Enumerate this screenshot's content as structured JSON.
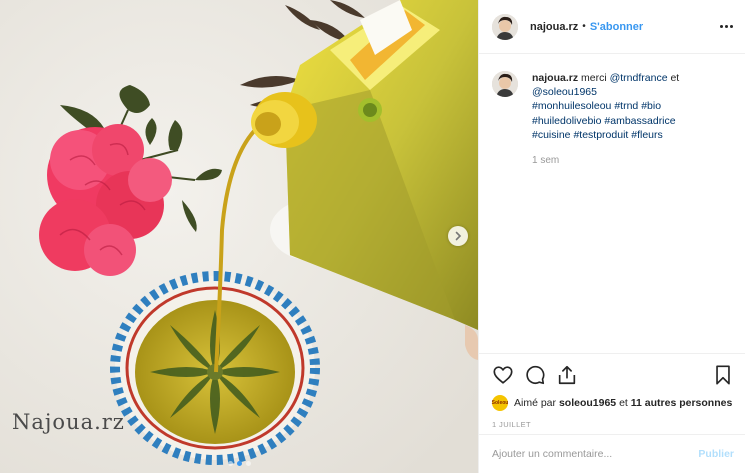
{
  "post": {
    "watermark": "Najoua.rz",
    "carousel": {
      "slide_count": 3,
      "active_index": 1
    }
  },
  "header": {
    "username": "najoua.rz",
    "separator": "•",
    "follow_label": "S'abonner"
  },
  "caption": {
    "username": "najoua.rz",
    "text_prefix": "merci",
    "mention1": "@trndfrance",
    "and_word": "et",
    "mention2": "@soleou1965",
    "hashtags": [
      "#monhuilesoleou",
      "#trnd",
      "#bio",
      "#huiledolivebio",
      "#ambassadrice",
      "#cuisine",
      "#testproduit",
      "#fleurs"
    ],
    "time": "1 sem"
  },
  "actions": {
    "icons": [
      "heart-icon",
      "comment-icon",
      "share-icon",
      "bookmark-icon"
    ],
    "likes_prefix": "Aimé par",
    "likes_user": "soleou1965",
    "likes_middle": "et",
    "likes_others": "11 autres personnes",
    "like_avatar_text": "Soleou",
    "date": "1 JUILLET"
  },
  "comment_box": {
    "placeholder": "Ajouter un commentaire...",
    "publish_label": "Publier"
  },
  "colors": {
    "link": "#003569",
    "accent": "#3897f0",
    "publish_disabled": "#b2dffc",
    "muted": "#999999"
  }
}
